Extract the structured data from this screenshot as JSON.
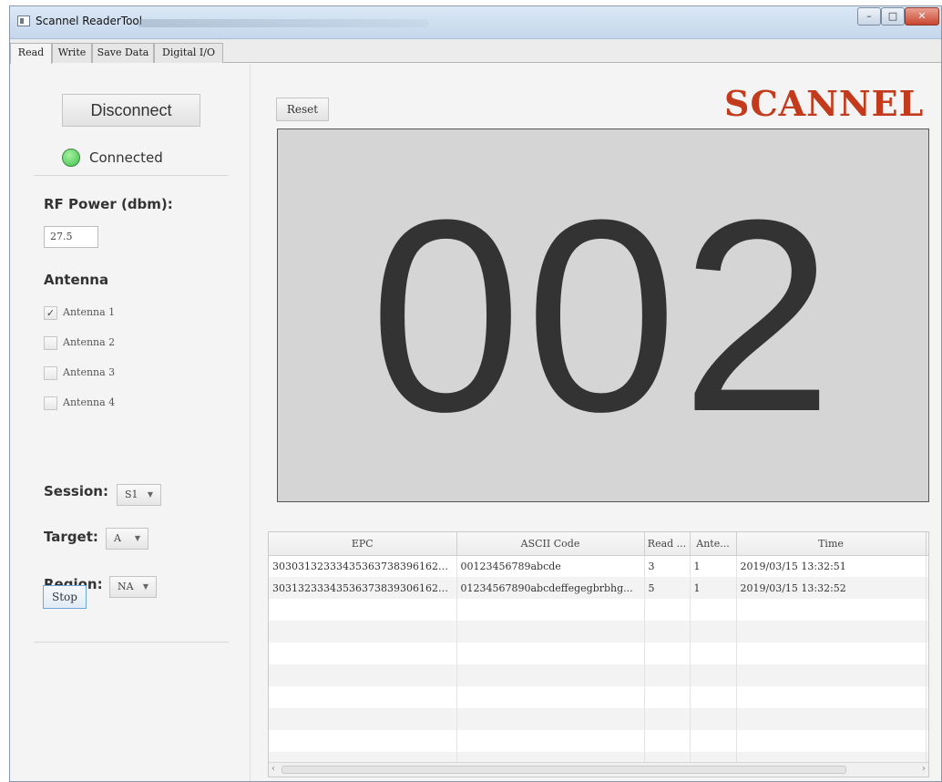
{
  "window": {
    "title": "Scannel ReaderTool"
  },
  "window_controls": {
    "minimize": "–",
    "maximize": "□",
    "close": "✕"
  },
  "tabs": [
    {
      "label": "Read",
      "active": true
    },
    {
      "label": "Write",
      "active": false
    },
    {
      "label": "Save Data",
      "active": false
    },
    {
      "label": "Digital I/O",
      "active": false
    }
  ],
  "connection": {
    "button_label": "Disconnect",
    "status": "Connected",
    "status_color": "#3cc14a"
  },
  "rf_power": {
    "label": "RF Power (dbm):",
    "value": "27.5"
  },
  "antenna": {
    "label": "Antenna",
    "items": [
      {
        "label": "Antenna 1",
        "checked": true
      },
      {
        "label": "Antenna 2",
        "checked": false
      },
      {
        "label": "Antenna 3",
        "checked": false
      },
      {
        "label": "Antenna 4",
        "checked": false
      }
    ]
  },
  "session": {
    "label": "Session:",
    "value": "S1"
  },
  "target": {
    "label": "Target:",
    "value": "A"
  },
  "region": {
    "label": "Region:",
    "value": "NA"
  },
  "stop_button": "Stop",
  "reset_button": "Reset",
  "logo": {
    "text": "SCANNEL",
    "color": "#c23b1c"
  },
  "counter": "002",
  "table": {
    "columns": [
      "EPC",
      "ASCII Code",
      "Read ...",
      "Ante...",
      "Time"
    ],
    "rows": [
      [
        "303031323334353637383961626...",
        "00123456789abcde",
        "3",
        "1",
        "2019/03/15 13:32:51"
      ],
      [
        "303132333435363738393061626...",
        "01234567890abcdeffegegbrbhg...",
        "5",
        "1",
        "2019/03/15 13:32:52"
      ]
    ],
    "overflow_char": "9"
  }
}
